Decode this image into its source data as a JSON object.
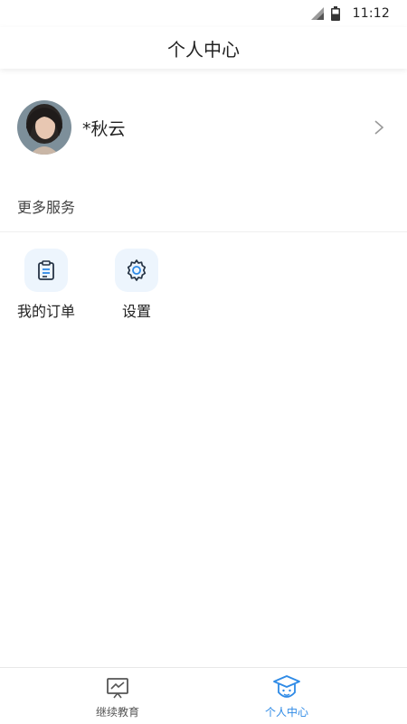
{
  "status_bar": {
    "time": "11:12",
    "signal_icon": "signal-icon",
    "battery_icon": "battery-icon"
  },
  "header": {
    "title": "个人中心"
  },
  "profile": {
    "name": "*秋云",
    "avatar_icon": "avatar",
    "chevron_icon": "chevron-right-icon"
  },
  "more_services": {
    "title": "更多服务",
    "items": [
      {
        "label": "我的订单",
        "icon": "clipboard-icon"
      },
      {
        "label": "设置",
        "icon": "gear-icon"
      }
    ]
  },
  "tabbar": {
    "tabs": [
      {
        "label": "继续教育",
        "icon": "chart-board-icon",
        "active": false
      },
      {
        "label": "个人中心",
        "icon": "graduation-cap-icon",
        "active": true
      }
    ]
  },
  "colors": {
    "accent": "#2e8ae6",
    "icon_bg": "#edf5fd",
    "text": "#222222"
  }
}
